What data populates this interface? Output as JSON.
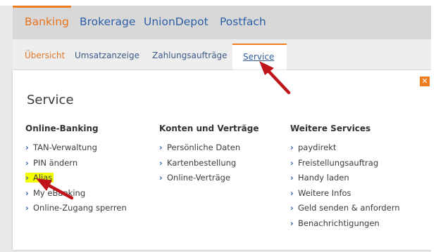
{
  "top_nav": {
    "items": [
      {
        "label": "Banking",
        "active": true
      },
      {
        "label": "Brokerage",
        "active": false
      },
      {
        "label": "UnionDepot",
        "active": false
      },
      {
        "label": "Postfach",
        "active": false
      }
    ]
  },
  "sub_nav": {
    "items": [
      {
        "label": "Übersicht"
      },
      {
        "label": "Umsatzanzeige"
      },
      {
        "label": "Zahlungsaufträge"
      },
      {
        "label": "Service"
      }
    ]
  },
  "panel": {
    "title": "Service",
    "close_label": "✕",
    "columns": [
      {
        "heading": "Online-Banking",
        "items": [
          {
            "label": "TAN-Verwaltung"
          },
          {
            "label": "PIN ändern"
          },
          {
            "label": "Alias",
            "highlighted": true
          },
          {
            "label": "My eBanking"
          },
          {
            "label": "Online-Zugang sperren"
          }
        ]
      },
      {
        "heading": "Konten und Verträge",
        "items": [
          {
            "label": "Persönliche Daten"
          },
          {
            "label": "Kartenbestellung"
          },
          {
            "label": "Online-Verträge"
          }
        ]
      },
      {
        "heading": "Weitere Services",
        "items": [
          {
            "label": "paydirekt"
          },
          {
            "label": "Freistellungsauftrag"
          },
          {
            "label": "Handy laden"
          },
          {
            "label": "Weitere Infos"
          },
          {
            "label": "Geld senden & anfordern"
          },
          {
            "label": "Benachrichtigungen"
          }
        ]
      }
    ]
  },
  "edge_glyphs": [
    "e",
    "e"
  ],
  "colors": {
    "accent": "#ef7c1e",
    "link": "#2b5fa6",
    "highlight": "#f3ff00",
    "annotation_arrow": "#c0141b"
  },
  "icons": {
    "chevron": "chevron-right-icon",
    "close": "close-icon",
    "arrow": "annotation-arrow-icon"
  }
}
